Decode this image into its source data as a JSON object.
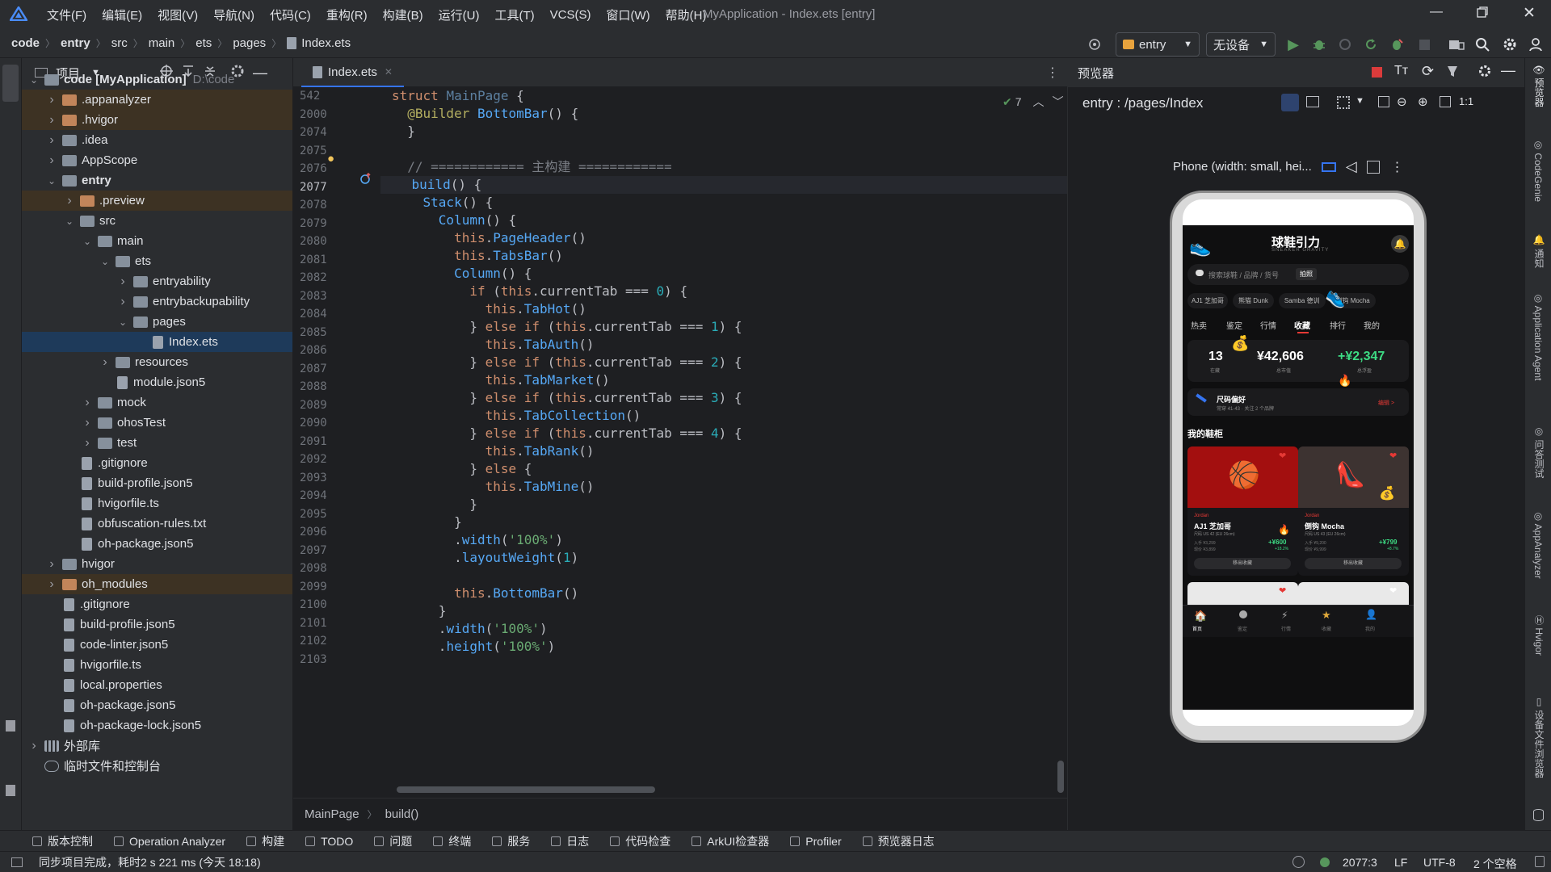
{
  "menubar": {
    "items": [
      "文件(F)",
      "编辑(E)",
      "视图(V)",
      "导航(N)",
      "代码(C)",
      "重构(R)",
      "构建(B)",
      "运行(U)",
      "工具(T)",
      "VCS(S)",
      "窗口(W)",
      "帮助(H)"
    ],
    "title": "MyApplication - Index.ets [entry]"
  },
  "breadcrumb": [
    "code",
    "entry",
    "src",
    "main",
    "ets",
    "pages",
    "Index.ets"
  ],
  "toolbar": {
    "module": "entry",
    "device": "无设备"
  },
  "project_panel": {
    "title": "项目",
    "tree": [
      {
        "label": "code [MyApplication]",
        "path": "D:\\code",
        "kind": "folder",
        "expanded": true,
        "depth": 0,
        "bold": true
      },
      {
        "label": ".appanalyzer",
        "kind": "folder-orange",
        "expanded": false,
        "depth": 1,
        "hl": true
      },
      {
        "label": ".hvigor",
        "kind": "folder-orange",
        "expanded": false,
        "depth": 1,
        "hl": true
      },
      {
        "label": ".idea",
        "kind": "folder",
        "expanded": false,
        "depth": 1
      },
      {
        "label": "AppScope",
        "kind": "folder",
        "expanded": false,
        "depth": 1
      },
      {
        "label": "entry",
        "kind": "folder",
        "expanded": true,
        "depth": 1,
        "bold": true
      },
      {
        "label": ".preview",
        "kind": "folder-orange",
        "expanded": false,
        "depth": 2,
        "hl": true
      },
      {
        "label": "src",
        "kind": "folder",
        "expanded": true,
        "depth": 2
      },
      {
        "label": "main",
        "kind": "folder",
        "expanded": true,
        "depth": 3
      },
      {
        "label": "ets",
        "kind": "folder",
        "expanded": true,
        "depth": 4
      },
      {
        "label": "entryability",
        "kind": "folder",
        "expanded": false,
        "depth": 5
      },
      {
        "label": "entrybackupability",
        "kind": "folder",
        "expanded": false,
        "depth": 5
      },
      {
        "label": "pages",
        "kind": "folder",
        "expanded": true,
        "depth": 5
      },
      {
        "label": "Index.ets",
        "kind": "file",
        "depth": 6,
        "selected": true
      },
      {
        "label": "resources",
        "kind": "folder",
        "expanded": false,
        "depth": 4
      },
      {
        "label": "module.json5",
        "kind": "file",
        "depth": 4
      },
      {
        "label": "mock",
        "kind": "folder",
        "expanded": false,
        "depth": 3
      },
      {
        "label": "ohosTest",
        "kind": "folder",
        "expanded": false,
        "depth": 3
      },
      {
        "label": "test",
        "kind": "folder",
        "expanded": false,
        "depth": 3
      },
      {
        "label": ".gitignore",
        "kind": "file",
        "depth": 2
      },
      {
        "label": "build-profile.json5",
        "kind": "file",
        "depth": 2
      },
      {
        "label": "hvigorfile.ts",
        "kind": "file",
        "depth": 2
      },
      {
        "label": "obfuscation-rules.txt",
        "kind": "file",
        "depth": 2
      },
      {
        "label": "oh-package.json5",
        "kind": "file",
        "depth": 2
      },
      {
        "label": "hvigor",
        "kind": "folder",
        "expanded": false,
        "depth": 1
      },
      {
        "label": "oh_modules",
        "kind": "folder-orange",
        "expanded": false,
        "depth": 1,
        "hl": true
      },
      {
        "label": ".gitignore",
        "kind": "file",
        "depth": 1
      },
      {
        "label": "build-profile.json5",
        "kind": "file",
        "depth": 1
      },
      {
        "label": "code-linter.json5",
        "kind": "file",
        "depth": 1
      },
      {
        "label": "hvigorfile.ts",
        "kind": "file",
        "depth": 1
      },
      {
        "label": "local.properties",
        "kind": "file",
        "depth": 1
      },
      {
        "label": "oh-package.json5",
        "kind": "file",
        "depth": 1
      },
      {
        "label": "oh-package-lock.json5",
        "kind": "file",
        "depth": 1
      },
      {
        "label": "外部库",
        "kind": "lib",
        "expanded": false,
        "depth": 0
      },
      {
        "label": "临时文件和控制台",
        "kind": "scratch",
        "depth": 0
      }
    ]
  },
  "editor": {
    "tab": "Index.ets",
    "inspection_count": "7",
    "line_numbers": [
      "542",
      "2000",
      "2074",
      "2075",
      "2076",
      "2077",
      "2078",
      "2079",
      "2080",
      "2081",
      "2082",
      "2083",
      "2084",
      "2085",
      "2086",
      "2087",
      "2088",
      "2089",
      "2090",
      "2091",
      "2092",
      "2093",
      "2094",
      "2095",
      "2096",
      "2097",
      "2098",
      "2099",
      "2100",
      "2101",
      "2102",
      "2103"
    ],
    "breadcrumb": [
      "MainPage",
      "build()"
    ]
  },
  "previewer": {
    "title": "预览器",
    "route": "entry : /pages/Index",
    "device_label": "Phone (width: small, hei..."
  },
  "app": {
    "title": "球鞋引力",
    "subtitle": "SNEAKER GRAVITY",
    "search_placeholder": "搜索球鞋 / 品牌 / 货号",
    "scan_label": "拍照",
    "chips": [
      "AJ1 芝加哥",
      "熊猫 Dunk",
      "Samba 德训",
      "倒钩 Mocha"
    ],
    "tabs": [
      "热卖",
      "鉴定",
      "行情",
      "收藏",
      "排行",
      "我的"
    ],
    "active_tab": "收藏",
    "stats": [
      {
        "value": "13",
        "label": "在藏",
        "color": "#ffffff"
      },
      {
        "value": "¥42,606",
        "label": "总市值",
        "color": "#ffffff"
      },
      {
        "value": "+¥2,347",
        "label": "总浮盈",
        "color": "#3ddc84"
      }
    ],
    "size_card": {
      "title": "尺码偏好",
      "desc": "常穿 41-43 · 关注 2 个品牌",
      "action": "编辑 >"
    },
    "section_title": "我的鞋柜",
    "shoes": [
      {
        "brand": "Jordan",
        "name": "AJ1 芝加哥",
        "size": "尺码 US 42 (EU 26cm)",
        "buy": "入手 ¥3,299",
        "market": "现价 ¥3,899",
        "gain": "+¥600",
        "gain_pct": "+18.2%",
        "action": "移出收藏"
      },
      {
        "brand": "Jordan",
        "name": "倒钩 Mocha",
        "size": "尺码 US 43 (EU 26cm)",
        "buy": "入手 ¥9,200",
        "market": "现价 ¥9,999",
        "gain": "+¥799",
        "gain_pct": "+8.7%",
        "action": "移出收藏"
      }
    ],
    "bottom_nav": [
      "首页",
      "鉴定",
      "行情",
      "收藏",
      "我的"
    ]
  },
  "tool_windows": [
    "版本控制",
    "Operation Analyzer",
    "构建",
    "TODO",
    "问题",
    "终端",
    "服务",
    "日志",
    "代码检查",
    "ArkUI检查器",
    "Profiler",
    "预览器日志"
  ],
  "status": {
    "message": "同步项目完成，耗时2 s 221 ms (今天 18:18)",
    "position": "2077:3",
    "line_sep": "LF",
    "encoding": "UTF-8",
    "indent": "2 个空格"
  },
  "colors": {
    "accent": "#3574f0",
    "gain": "#3ddc84",
    "editor_bg": "#1e1f22",
    "panel_bg": "#2b2d30",
    "red_card": "#a30f0f"
  }
}
